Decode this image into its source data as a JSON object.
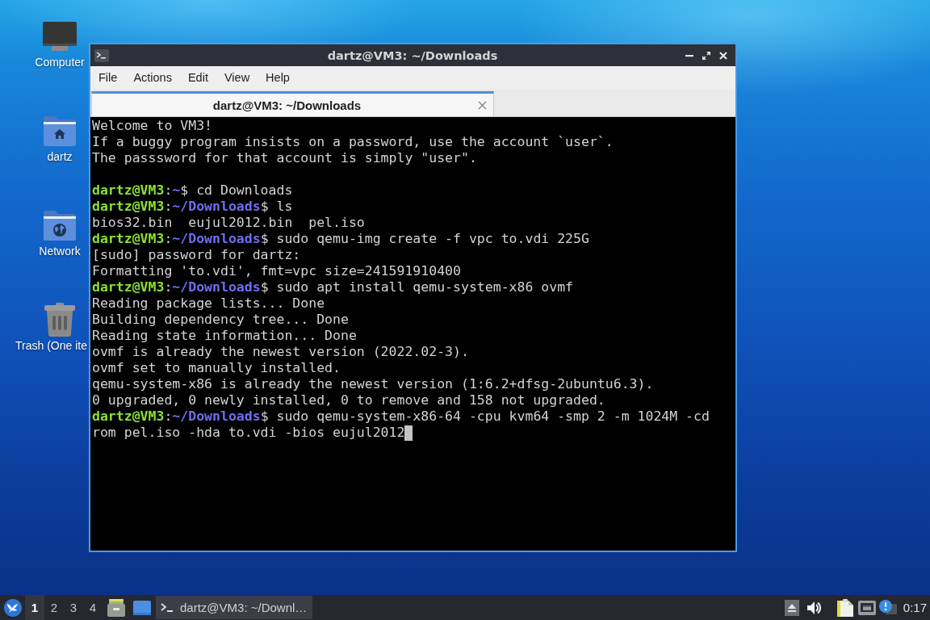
{
  "desktop": {
    "icons": [
      {
        "kind": "computer",
        "label": "Computer"
      },
      {
        "kind": "home",
        "label": "dartz"
      },
      {
        "kind": "network",
        "label": "Network"
      },
      {
        "kind": "trash",
        "label": "Trash (One ite"
      }
    ]
  },
  "window": {
    "title": "dartz@VM3: ~/Downloads"
  },
  "menu": [
    "File",
    "Actions",
    "Edit",
    "View",
    "Help"
  ],
  "tabs": [
    {
      "label": "dartz@VM3: ~/Downloads",
      "selected": true
    }
  ],
  "terminal": {
    "lines": [
      {
        "kind": "text",
        "text": "Welcome to VM3!"
      },
      {
        "kind": "text",
        "text": "If a buggy program insists on a password, use the account `user`."
      },
      {
        "kind": "text",
        "text": "The passsword for that account is simply \"user\"."
      },
      {
        "kind": "blank"
      },
      {
        "kind": "prompt",
        "user": "dartz@VM3",
        "separator": ":",
        "path": "~",
        "symbol": "$",
        "command": "cd Downloads"
      },
      {
        "kind": "prompt",
        "user": "dartz@VM3",
        "separator": ":",
        "path": "~/Downloads",
        "symbol": "$",
        "command": "ls"
      },
      {
        "kind": "text",
        "text": "bios32.bin  eujul2012.bin  pel.iso"
      },
      {
        "kind": "prompt",
        "user": "dartz@VM3",
        "separator": ":",
        "path": "~/Downloads",
        "symbol": "$",
        "command": "sudo qemu-img create -f vpc to.vdi 225G"
      },
      {
        "kind": "text",
        "text": "[sudo] password for dartz:"
      },
      {
        "kind": "text",
        "text": "Formatting 'to.vdi', fmt=vpc size=241591910400"
      },
      {
        "kind": "prompt",
        "user": "dartz@VM3",
        "separator": ":",
        "path": "~/Downloads",
        "symbol": "$",
        "command": "sudo apt install qemu-system-x86 ovmf"
      },
      {
        "kind": "text",
        "text": "Reading package lists... Done"
      },
      {
        "kind": "text",
        "text": "Building dependency tree... Done"
      },
      {
        "kind": "text",
        "text": "Reading state information... Done"
      },
      {
        "kind": "text",
        "text": "ovmf is already the newest version (2022.02-3)."
      },
      {
        "kind": "text",
        "text": "ovmf set to manually installed."
      },
      {
        "kind": "text",
        "text": "qemu-system-x86 is already the newest version (1:6.2+dfsg-2ubuntu6.3)."
      },
      {
        "kind": "text",
        "text": "0 upgraded, 0 newly installed, 0 to remove and 158 not upgraded."
      },
      {
        "kind": "prompt",
        "user": "dartz@VM3",
        "separator": ":",
        "path": "~/Downloads",
        "symbol": "$",
        "command": "sudo qemu-system-x86-64 -cpu kvm64 -smp 2 -m 1024M -cd"
      },
      {
        "kind": "text",
        "text": "rom pel.iso -hda to.vdi -bios eujul2012"
      }
    ],
    "cursor": true
  },
  "taskbar": {
    "workspaces": [
      {
        "label": "1",
        "selected": true
      },
      {
        "label": "2",
        "selected": false
      },
      {
        "label": "3",
        "selected": false
      },
      {
        "label": "4",
        "selected": false
      }
    ],
    "tasks": [
      {
        "label": "dartz@VM3: ~/Downl…",
        "active": true
      }
    ],
    "clock": "0:17"
  }
}
